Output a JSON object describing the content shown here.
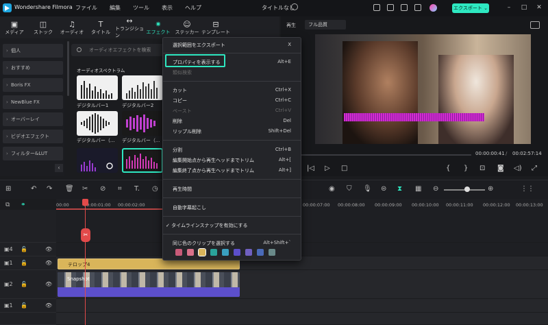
{
  "app": {
    "name": "Wondershare Filmora",
    "doc_title": "タイトルなし",
    "export_label": "エクスポート"
  },
  "menus": [
    "ファイル",
    "編集",
    "ツール",
    "表示",
    "ヘルプ"
  ],
  "tabs": [
    {
      "label": "メディア",
      "icon": "media-icon"
    },
    {
      "label": "ストック",
      "icon": "stock-icon"
    },
    {
      "label": "オーディオ",
      "icon": "audio-icon"
    },
    {
      "label": "タイトル",
      "icon": "title-icon"
    },
    {
      "label": "トランジション",
      "icon": "transition-icon"
    },
    {
      "label": "エフェクト",
      "icon": "effects-icon"
    },
    {
      "label": "ステッカー",
      "icon": "sticker-icon"
    },
    {
      "label": "テンプレート",
      "icon": "template-icon"
    }
  ],
  "sidebar": [
    "個人",
    "おすすめ",
    "Boris FX",
    "NewBlue FX",
    "オーバーレイ",
    "ビデオエフェクト",
    "フィルター&LUT"
  ],
  "search": {
    "placeholder": "オーディオエフェクトを検索"
  },
  "gallery": {
    "section": "オーディオスペクトラム",
    "items": [
      "デジタルバー1",
      "デジタルバー2",
      "デジタルバー（...",
      "デジタルバー（..."
    ]
  },
  "preview": {
    "label": "再生",
    "quality": "フル品質",
    "current": "00:00:00:41",
    "total": "00:02:57:14"
  },
  "ruler": [
    "00:00",
    "00:00:01:00",
    "00:00:02:00",
    "00:00:07:00",
    "00:00:08:00",
    "00:00:09:00",
    "00:00:10:00",
    "00:00:11:00",
    "00:00:12:00",
    "00:00:13:00"
  ],
  "clips": {
    "text": "テロップ4",
    "video": "Snapshot"
  },
  "context_menu": {
    "items": [
      {
        "label": "選択範囲をエクスポート",
        "key": "X",
        "disabled": false
      },
      {
        "label": "プロパティを表示する",
        "key": "Alt+E",
        "disabled": false
      },
      {
        "label": "類似検索",
        "key": "",
        "disabled": true
      },
      {
        "label": "カット",
        "key": "Ctrl+X",
        "disabled": false
      },
      {
        "label": "コピー",
        "key": "Ctrl+C",
        "disabled": false
      },
      {
        "label": "ペースト",
        "key": "Ctrl+V",
        "disabled": true
      },
      {
        "label": "削除",
        "key": "Del",
        "disabled": false
      },
      {
        "label": "リップル削除",
        "key": "Shift+Del",
        "disabled": false
      },
      {
        "label": "分割",
        "key": "Ctrl+B",
        "disabled": false
      },
      {
        "label": "編集開始点から再生ヘッドまでトリム",
        "key": "Alt+[",
        "disabled": false
      },
      {
        "label": "編集終了点から再生ヘッドまでトリム",
        "key": "Alt+]",
        "disabled": false
      },
      {
        "label": "再生時間",
        "key": "",
        "disabled": false
      },
      {
        "label": "自動字幕起こし",
        "key": "",
        "disabled": false
      },
      {
        "label": "✓ タイムラインスナップを有効にする",
        "key": "",
        "disabled": false
      },
      {
        "label": "同じ色のクリップを選択する",
        "key": "Alt+Shift+`",
        "disabled": false
      }
    ],
    "swatches": [
      "#c85a78",
      "#d9718a",
      "#d9b55a",
      "#2aa39a",
      "#3aa0c0",
      "#5c4fcb",
      "#7060c0",
      "#4a6ab8",
      "#6a8a8a"
    ]
  },
  "colors": {
    "accent": "#2ee8c1",
    "playhead": "#e24a4a"
  }
}
